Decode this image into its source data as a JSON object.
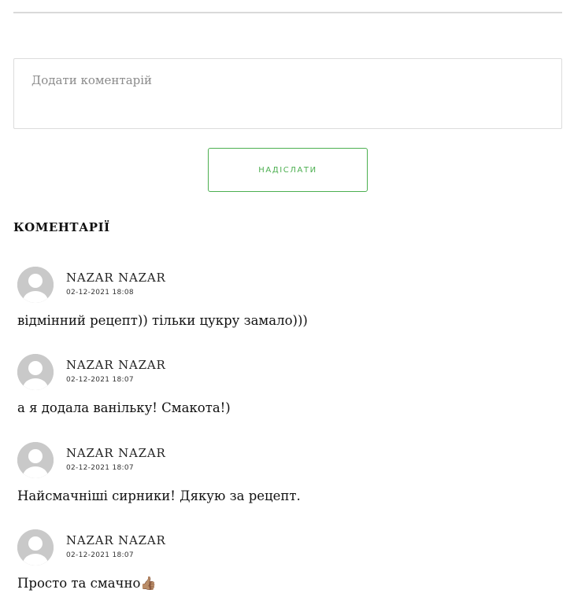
{
  "form": {
    "comment_placeholder": "Додати коментарій",
    "comment_value": "",
    "submit_label": "НАДІСЛАТИ",
    "accent_color": "#4caf50"
  },
  "comments_section": {
    "heading": "КОМЕНТАРІЇ",
    "avatar_icon": "default-user-avatar-icon",
    "items": [
      {
        "author": "NAZAR NAZAR",
        "date": "02-12-2021 18:08",
        "text": "відмінний рецепт)) тільки цукру замало)))"
      },
      {
        "author": "NAZAR NAZAR",
        "date": "02-12-2021 18:07",
        "text": "а я додала ванільку! Смакота!)"
      },
      {
        "author": "NAZAR NAZAR",
        "date": "02-12-2021 18:07",
        "text": "Найсмачніші сирники! Дякую за рецепт."
      },
      {
        "author": "NAZAR NAZAR",
        "date": "02-12-2021 18:07",
        "text": "Просто та смачно👍🏽"
      }
    ]
  }
}
